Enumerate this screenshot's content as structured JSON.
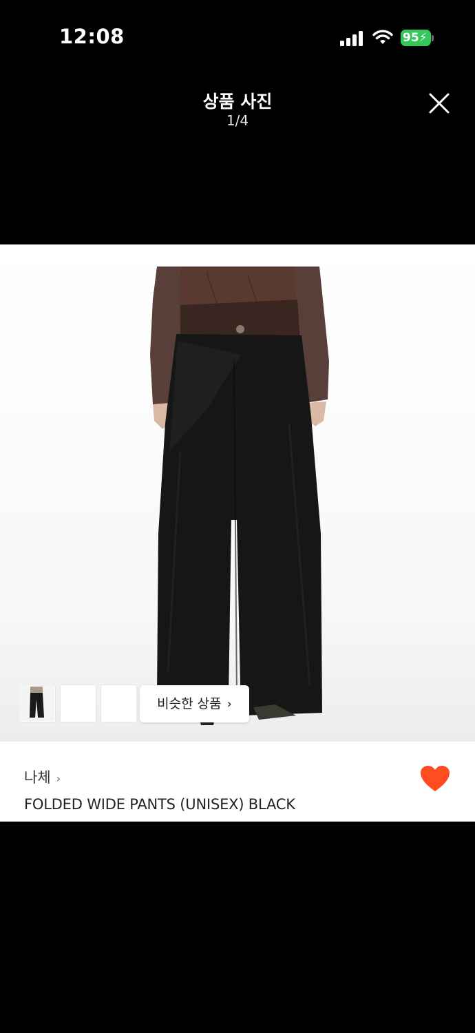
{
  "status_bar": {
    "time": "12:08",
    "battery": "95"
  },
  "viewer": {
    "title": "상품 사진",
    "page_indicator": "1/4"
  },
  "thumbnails": [
    {
      "name": "thumb-front"
    },
    {
      "name": "thumb-side"
    },
    {
      "name": "thumb-back"
    }
  ],
  "similar_button": {
    "label": "비슷한 상품",
    "chevron": "›"
  },
  "product": {
    "brand": "나체",
    "brand_chevron": "›",
    "name": "FOLDED WIDE PANTS (UNISEX) BLACK",
    "liked": true
  },
  "colors": {
    "heart": "#ff4d1f",
    "battery": "#34c759"
  },
  "icons": [
    "signal-icon",
    "wifi-icon",
    "battery-icon",
    "close-icon",
    "heart-icon",
    "chevron-right-icon"
  ]
}
